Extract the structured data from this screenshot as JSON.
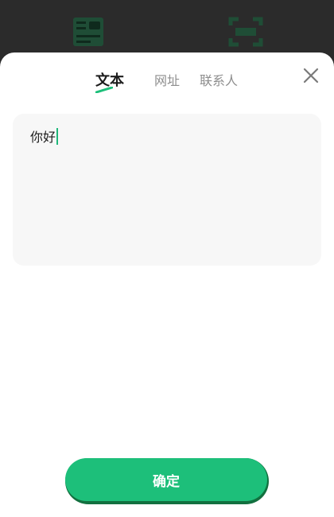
{
  "tabs": {
    "items": [
      {
        "label": "文本",
        "active": true
      },
      {
        "label": "网址",
        "active": false
      },
      {
        "label": "联系人",
        "active": false
      }
    ]
  },
  "text_input": {
    "value": "你好"
  },
  "actions": {
    "confirm_label": "确定"
  },
  "icons": {
    "close": "close-icon",
    "background_left": "barcode-card-icon",
    "background_right": "scan-frame-icon"
  },
  "colors": {
    "accent": "#1dbf7a",
    "caret": "#1fb77a",
    "input_bg": "#f7f7f7"
  }
}
